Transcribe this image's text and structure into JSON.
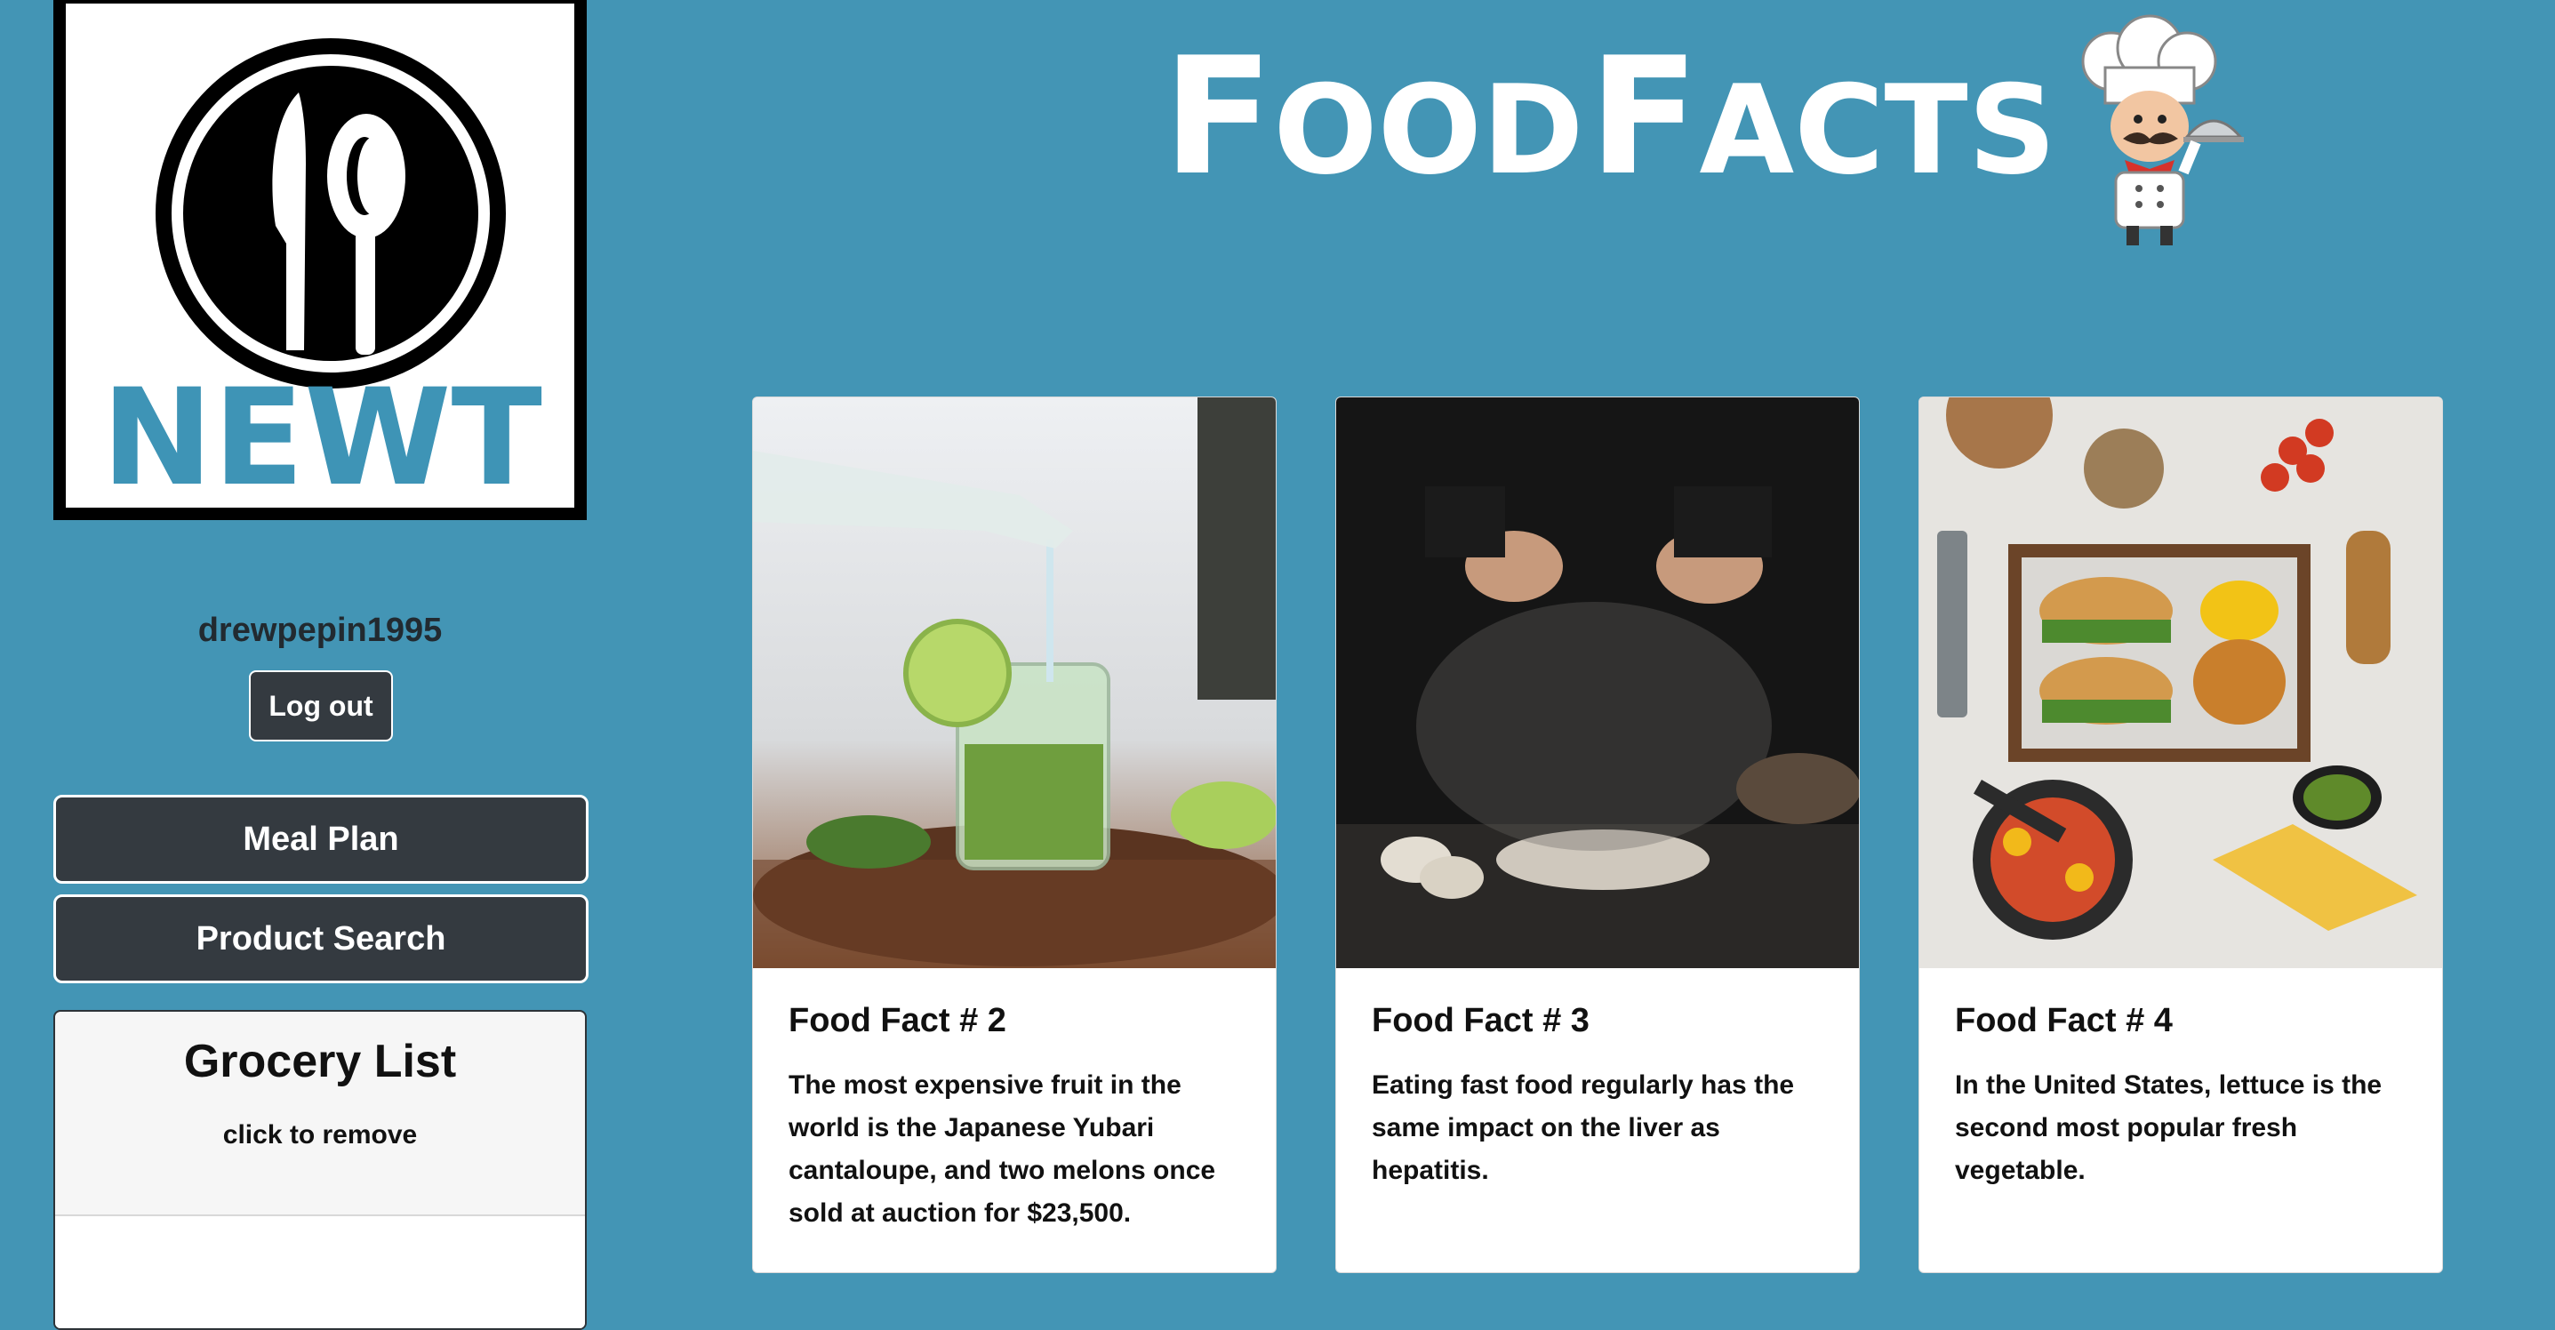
{
  "logo": {
    "text": "NEWT",
    "icon": "fork-spoon-plate-icon"
  },
  "user": {
    "username": "drewpepin1995",
    "logout_label": "Log out"
  },
  "nav": {
    "meal_plan": "Meal Plan",
    "product_search": "Product Search"
  },
  "grocery": {
    "title": "Grocery List",
    "subtitle": "click to remove"
  },
  "header": {
    "title_first": "F",
    "title_first_rest": "OOD",
    "title_second": "F",
    "title_second_rest": "ACTS",
    "mascot_icon": "chef-icon"
  },
  "cards": [
    {
      "title": "Food Fact # 2",
      "text": "The most expensive fruit in the world is the Japanese Yubari cantaloupe, and two melons once sold at auction for $23,500.",
      "image": "drink-pouring-image"
    },
    {
      "title": "Food Fact # 3",
      "text": "Eating fast food regularly has the same impact on the liver as hepatitis.",
      "image": "flour-dusting-image"
    },
    {
      "title": "Food Fact # 4",
      "text": "In the United States, lettuce is the second most popular fresh vegetable.",
      "image": "burger-fries-spread-image"
    }
  ],
  "colors": {
    "background": "#4395b5",
    "button": "#343a40",
    "logo_text": "#3e94b6"
  }
}
